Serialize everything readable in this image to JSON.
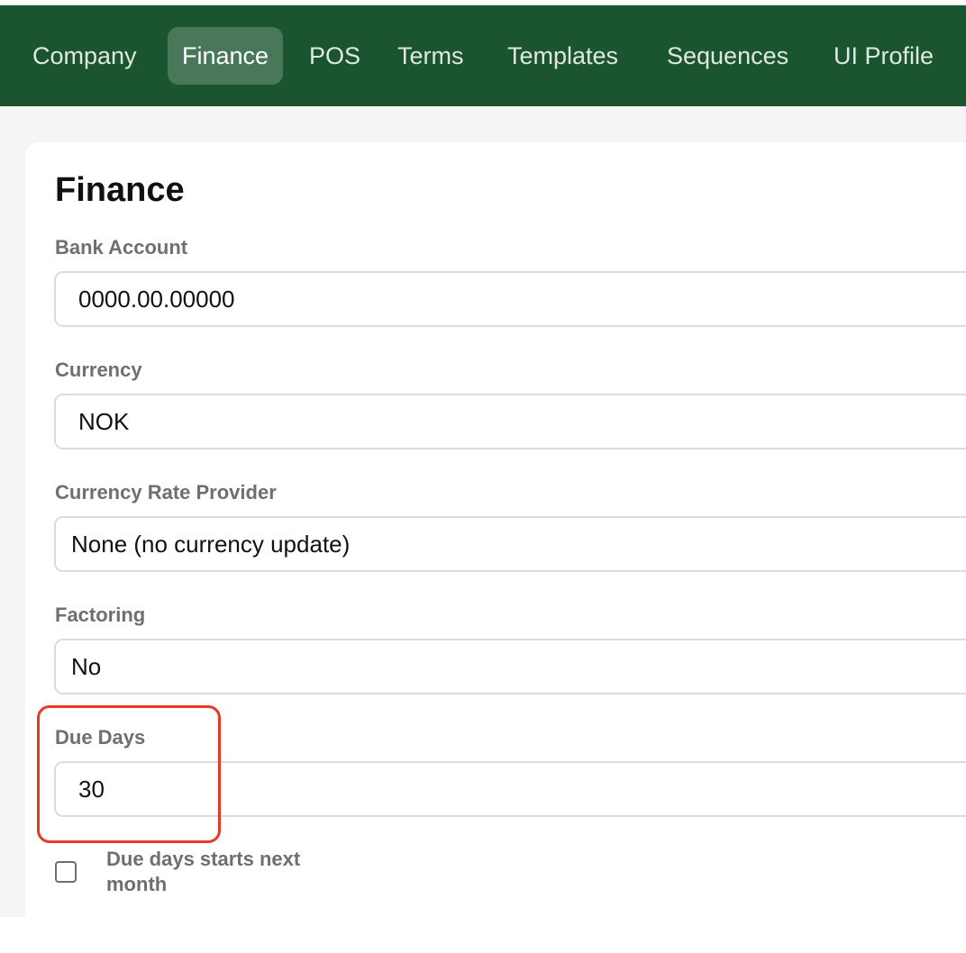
{
  "nav": {
    "tabs": [
      {
        "label": "Company"
      },
      {
        "label": "Finance"
      },
      {
        "label": "POS"
      },
      {
        "label": "Terms"
      },
      {
        "label": "Templates"
      },
      {
        "label": "Sequences"
      },
      {
        "label": "UI Profile"
      }
    ],
    "active_tab": "Finance"
  },
  "colors": {
    "nav_bg": "#1b5530",
    "highlight": "#e63a25"
  },
  "finance": {
    "title": "Finance",
    "bank_account": {
      "label": "Bank Account",
      "value": "0000.00.00000"
    },
    "currency": {
      "label": "Currency",
      "value": "NOK"
    },
    "currency_rate_provider": {
      "label": "Currency Rate Provider",
      "value": "None (no currency update)"
    },
    "factoring": {
      "label": "Factoring",
      "value": "No"
    },
    "due_days": {
      "label": "Due Days",
      "value": "30"
    },
    "due_days_next_month": {
      "label": "Due days starts next month",
      "checked": false
    }
  }
}
